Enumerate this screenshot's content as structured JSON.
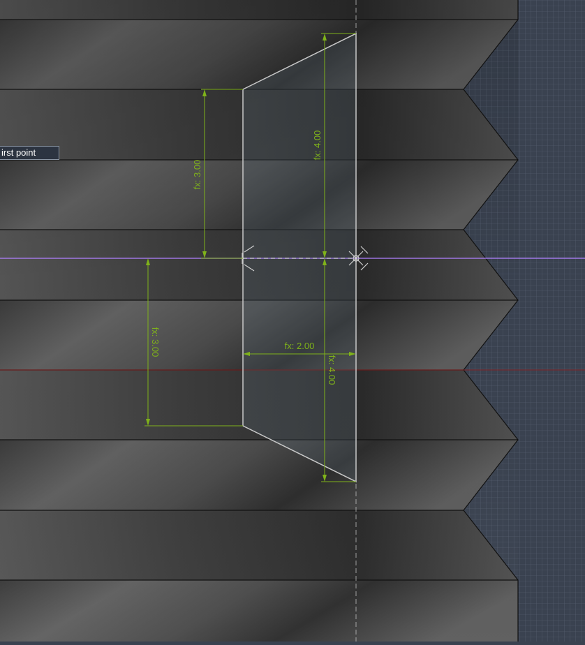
{
  "tooltip": {
    "text": "irst point"
  },
  "dimensions": {
    "top_left_height": "fx: 3.00",
    "right_upper_height": "fx: 4.00",
    "bottom_left_height": "fx: 3.00",
    "width": "fx: 2.00",
    "right_lower_height": "fx: 4.00"
  },
  "colors": {
    "dimension": "#7fb21a",
    "grid_bg": "#3a4250",
    "axis_x": "#b080ff",
    "axis_red": "#8a2020",
    "shape_edge": "#c8c8c8"
  },
  "icons": [
    "snap-cross-icon-left",
    "snap-cross-icon-right"
  ]
}
